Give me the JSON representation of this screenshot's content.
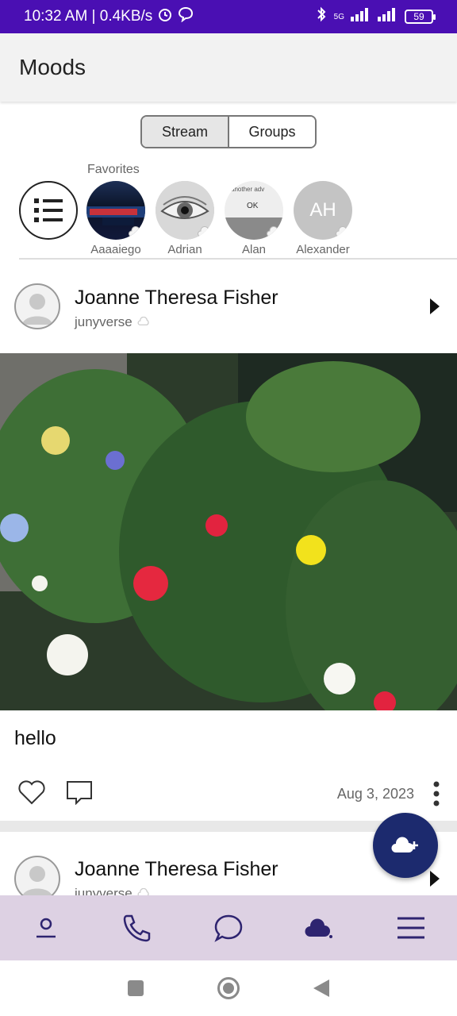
{
  "status_bar": {
    "left_text": "10:32 AM | 0.4KB/s",
    "network": "5G",
    "battery": "59"
  },
  "app_bar": {
    "title": "Moods"
  },
  "segmented": {
    "stream_label": "Stream",
    "groups_label": "Groups",
    "selected": "Stream"
  },
  "favorites": {
    "label": "Favorites",
    "items": [
      {
        "name": "Aaaaiego"
      },
      {
        "name": "Adrian"
      },
      {
        "name": "Alan",
        "thumb_text": "another adv",
        "thumb_button": "OK"
      },
      {
        "name": "Alexander",
        "initials": "AH"
      }
    ]
  },
  "posts": [
    {
      "author": "Joanne Theresa Fisher",
      "username": "junyverse",
      "text": "hello",
      "date": "Aug 3, 2023"
    },
    {
      "author": "Joanne Theresa Fisher",
      "username": "junyverse"
    }
  ],
  "colors": {
    "status_bar": "#4a0fb3",
    "fab": "#1c2a6e",
    "bottom_nav": "#ddd1e3",
    "nav_icon": "#2e2470"
  },
  "icons": {
    "list": "list-icon",
    "like": "heart-icon",
    "comment": "comment-icon",
    "more": "more-vertical-icon",
    "fab": "cloud-add-icon",
    "nav": [
      "profile-icon",
      "phone-icon",
      "chat-icon",
      "mood-icon",
      "menu-icon"
    ]
  }
}
